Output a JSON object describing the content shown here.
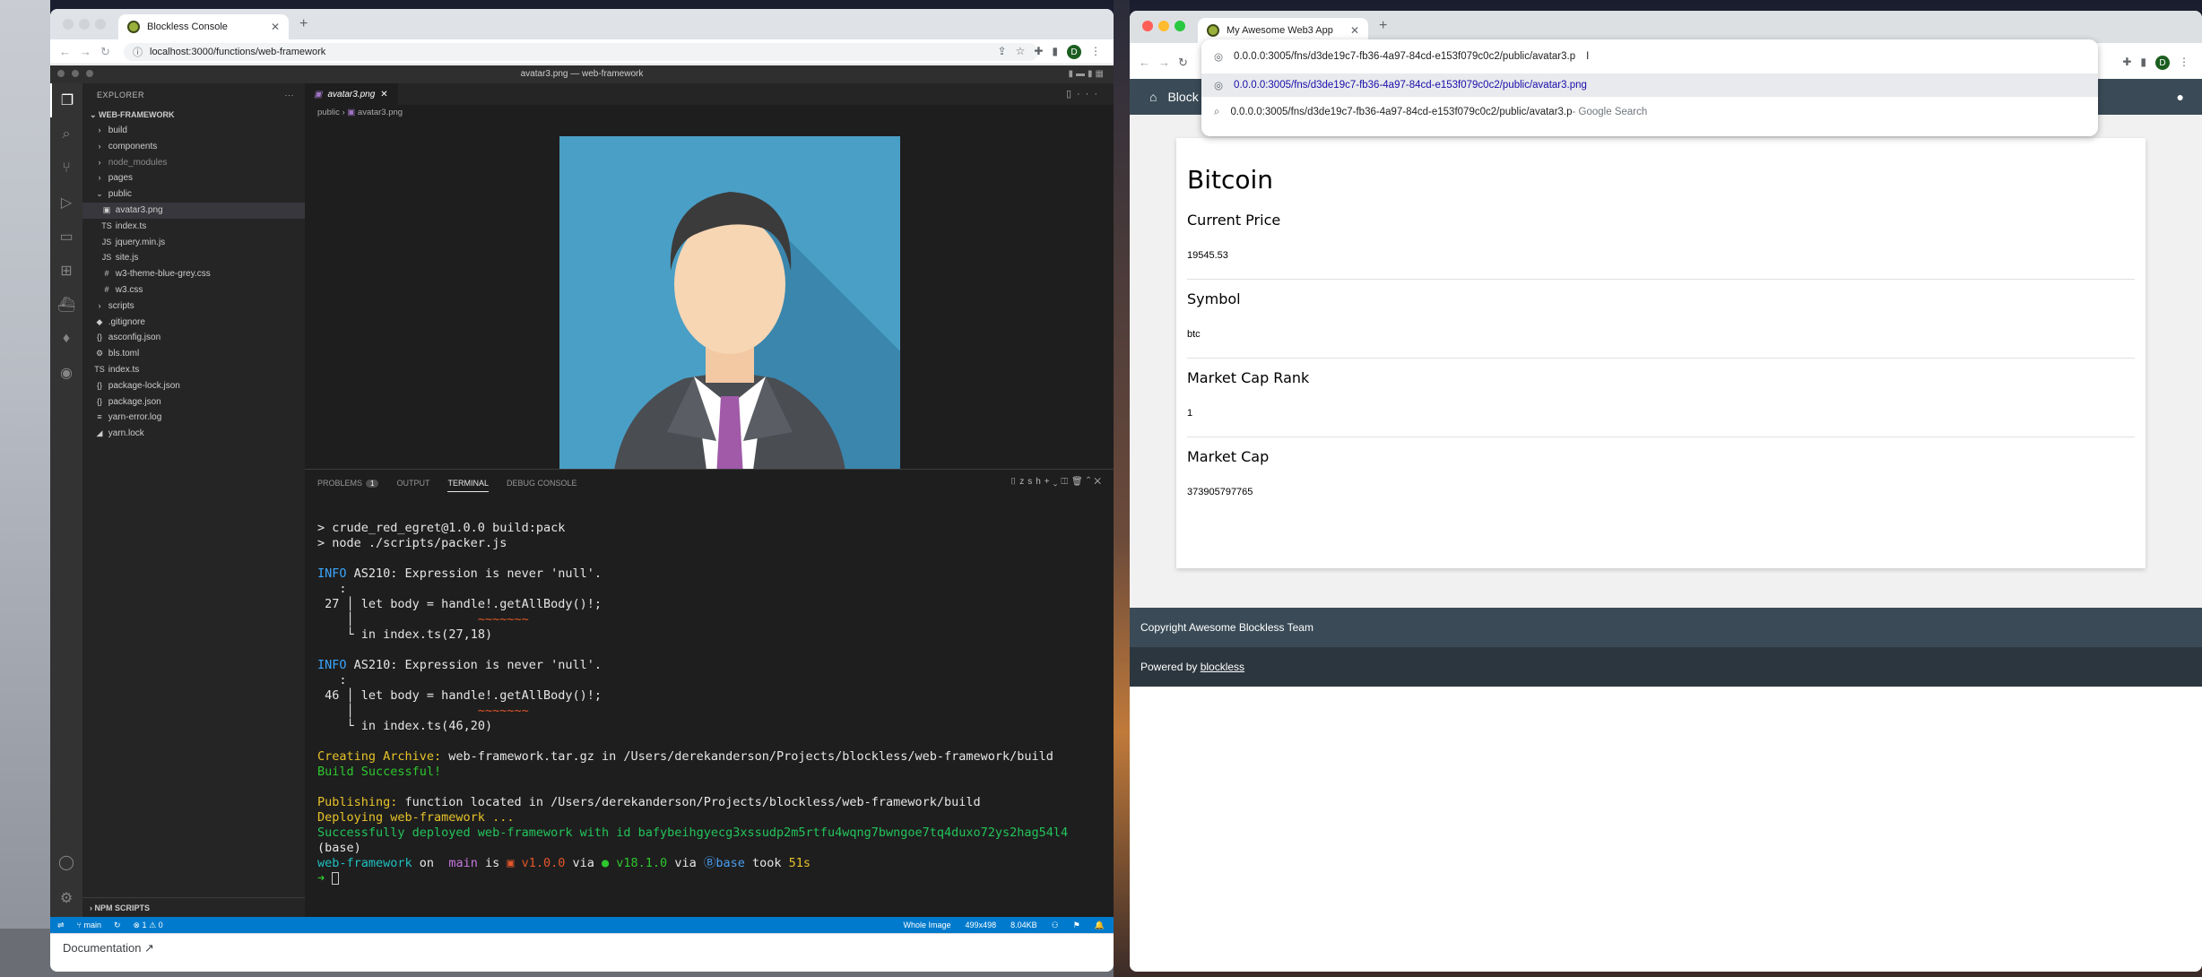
{
  "left_browser": {
    "tab_title": "Blockless Console",
    "url": "localhost:3000/functions/web-framework",
    "profile_initial": "D",
    "doc_button": "Documentation ↗"
  },
  "vscode": {
    "window_title": "avatar3.png — web-framework",
    "explorer_label": "EXPLORER",
    "project": "WEB-FRAMEWORK",
    "tree": [
      {
        "icon": "›",
        "label": "build",
        "indent": 0,
        "dim": false
      },
      {
        "icon": "›",
        "label": "components",
        "indent": 0,
        "dim": false
      },
      {
        "icon": "›",
        "label": "node_modules",
        "indent": 0,
        "dim": true
      },
      {
        "icon": "›",
        "label": "pages",
        "indent": 0,
        "dim": false
      },
      {
        "icon": "⌄",
        "label": "public",
        "indent": 0,
        "dim": false
      },
      {
        "icon": "▣",
        "label": "avatar3.png",
        "indent": 1,
        "dim": false,
        "selected": true
      },
      {
        "icon": "TS",
        "label": "index.ts",
        "indent": 1,
        "dim": false
      },
      {
        "icon": "JS",
        "label": "jquery.min.js",
        "indent": 1,
        "dim": false
      },
      {
        "icon": "JS",
        "label": "site.js",
        "indent": 1,
        "dim": false
      },
      {
        "icon": "#",
        "label": "w3-theme-blue-grey.css",
        "indent": 1,
        "dim": false
      },
      {
        "icon": "#",
        "label": "w3.css",
        "indent": 1,
        "dim": false
      },
      {
        "icon": "›",
        "label": "scripts",
        "indent": 0,
        "dim": false
      },
      {
        "icon": "◆",
        "label": ".gitignore",
        "indent": 0,
        "dim": false
      },
      {
        "icon": "{}",
        "label": "asconfig.json",
        "indent": 0,
        "dim": false
      },
      {
        "icon": "⚙",
        "label": "bls.toml",
        "indent": 0,
        "dim": false
      },
      {
        "icon": "TS",
        "label": "index.ts",
        "indent": 0,
        "dim": false
      },
      {
        "icon": "{}",
        "label": "package-lock.json",
        "indent": 0,
        "dim": false
      },
      {
        "icon": "{}",
        "label": "package.json",
        "indent": 0,
        "dim": false
      },
      {
        "icon": "≡",
        "label": "yarn-error.log",
        "indent": 0,
        "dim": false
      },
      {
        "icon": "◢",
        "label": "yarn.lock",
        "indent": 0,
        "dim": false
      }
    ],
    "npm_scripts": "NPM SCRIPTS",
    "editor_tab": "avatar3.png",
    "breadcrumb_folder": "public",
    "breadcrumb_file": "avatar3.png",
    "panel_tabs": {
      "problems": "PROBLEMS",
      "problems_count": "1",
      "output": "OUTPUT",
      "terminal": "TERMINAL",
      "debug": "DEBUG CONSOLE",
      "shell": "zsh"
    },
    "terminal": {
      "l1": "> crude_red_egret@1.0.0 build:pack",
      "l2": "> node ./scripts/packer.js",
      "info": "INFO",
      "as210": " AS210: Expression is never 'null'.",
      "n27": " 27 ",
      "code": "let body = handle!.getAllBody()!;",
      "in27": "in index.ts(27,18)",
      "n46": " 46 ",
      "in46": "in index.ts(46,20)",
      "creating": "Creating Archive:",
      "creating_rest": " web-framework.tar.gz in /Users/derekanderson/Projects/blockless/web-framework/build",
      "build_ok": "Build Successful!",
      "publishing": "Publishing:",
      "publishing_rest": " function located in /Users/derekanderson/Projects/blockless/web-framework/build",
      "deploying": "Deploying web-framework ...",
      "deployed": "Successfully deployed web-framework with id bafybeihgyecg3xssudp2m5rtfu4wqng7bwngoe7tq4duxo72ys2hag54l4",
      "base": "(base)",
      "p_dir": "web-framework",
      "p_on": " on ",
      "p_branch": " main",
      "p_is": " is ",
      "p_ver": "v1.0.0",
      "p_via": " via ",
      "p_node": "● v18.1.0",
      "p_via2": " via ",
      "p_base": "base",
      "p_took": " took ",
      "p_time": "51s",
      "prompt": "➜ "
    },
    "status": {
      "branch": "main",
      "errors": "⊗ 1 ⚠ 0",
      "whole_image": "Whole Image",
      "dims": "499x498",
      "size": "8.04KB"
    }
  },
  "right_browser": {
    "tab_title": "My Awesome Web3 App",
    "url_typed": "0.0.0.0:3005/fns/d3de19c7-fb36-4a97-84cd-e153f079c0c2/public/avatar3.p",
    "suggestion_1": "0.0.0.0:3005/fns/d3de19c7-fb36-4a97-84cd-e153f079c0c2/public/avatar3.png",
    "suggestion_2": "0.0.0.0:3005/fns/d3de19c7-fb36-4a97-84cd-e153f079c0c2/public/avatar3.p",
    "suggestion_2_suffix": " - Google Search",
    "profile_initial": "D",
    "nav_brand": "Block",
    "coin_name": "Bitcoin",
    "fields": [
      {
        "label": "Current Price",
        "value": "19545.53"
      },
      {
        "label": "Symbol",
        "value": "btc"
      },
      {
        "label": "Market Cap Rank",
        "value": "1"
      },
      {
        "label": "Market Cap",
        "value": "373905797765"
      }
    ],
    "footer_copyright": "Copyright Awesome Blockless Team",
    "footer_powered": "Powered by ",
    "footer_link": "blockless"
  }
}
